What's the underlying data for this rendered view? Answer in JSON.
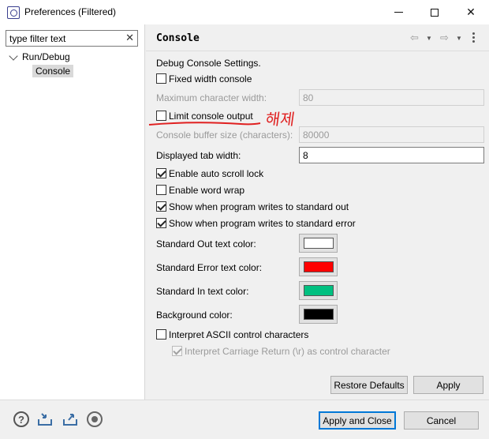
{
  "window": {
    "title": "Preferences (Filtered)"
  },
  "sidebar": {
    "filter_value": "type filter text",
    "tree": {
      "root": "Run/Debug",
      "child": "Console"
    }
  },
  "page": {
    "title": "Console",
    "section_heading": "Debug Console Settings.",
    "fixed_width": {
      "label": "Fixed width console",
      "checked": false
    },
    "max_char_width": {
      "label": "Maximum character width:",
      "value": "80",
      "enabled": false
    },
    "limit_output": {
      "label": "Limit console output",
      "checked": false
    },
    "annotation": "해제",
    "buffer_size": {
      "label": "Console buffer size (characters):",
      "value": "80000",
      "enabled": false
    },
    "tab_width": {
      "label": "Displayed tab width:",
      "value": "8"
    },
    "auto_scroll": {
      "label": "Enable auto scroll lock",
      "checked": true
    },
    "word_wrap": {
      "label": "Enable word wrap",
      "checked": false
    },
    "show_stdout": {
      "label": "Show when program writes to standard out",
      "checked": true
    },
    "show_stderr": {
      "label": "Show when program writes to standard error",
      "checked": true
    },
    "colors": [
      {
        "label": "Standard Out text color:",
        "color": "#ffffff"
      },
      {
        "label": "Standard Error text color:",
        "color": "#ff0000"
      },
      {
        "label": "Standard In text color:",
        "color": "#00c080"
      },
      {
        "label": "Background color:",
        "color": "#000000"
      }
    ],
    "ascii": {
      "label": "Interpret ASCII control characters",
      "checked": false
    },
    "carriage_return": {
      "label": "Interpret Carriage Return (\\r) as control character",
      "checked": true,
      "enabled": false
    },
    "restore_defaults": "Restore Defaults",
    "apply": "Apply"
  },
  "footer": {
    "apply_close": "Apply and Close",
    "cancel": "Cancel"
  },
  "colors": {
    "annotation": "#e02020",
    "accent": "#0078d7"
  }
}
